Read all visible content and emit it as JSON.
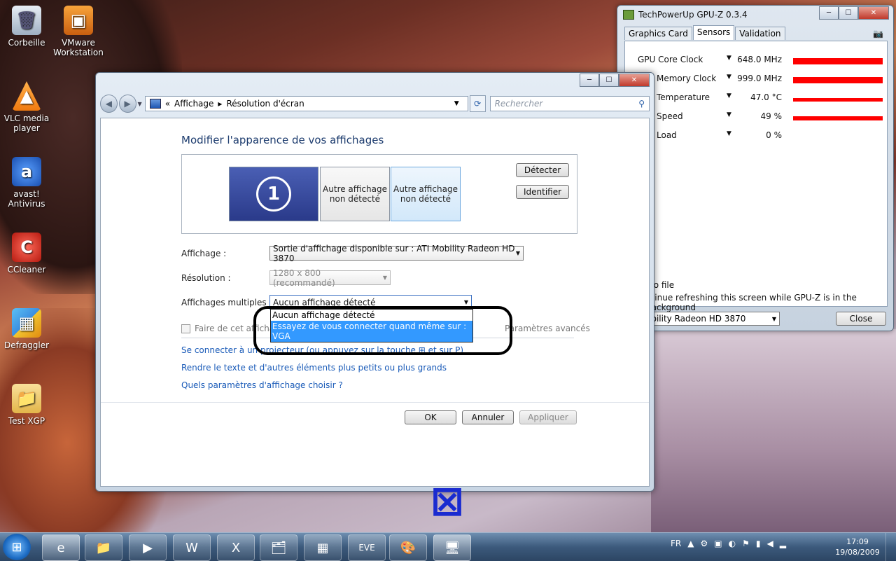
{
  "desktop": {
    "icons": [
      {
        "label": "Corbeille",
        "glyph": "🗑"
      },
      {
        "label": "VMware Workstation",
        "glyph": "▣"
      },
      {
        "label": "VLC media player",
        "glyph": "▲"
      },
      {
        "label": "avast! Antivirus",
        "glyph": "a"
      },
      {
        "label": "CCleaner",
        "glyph": "C"
      },
      {
        "label": "Defraggler",
        "glyph": "▦"
      },
      {
        "label": "Test XGP",
        "glyph": "📁"
      }
    ]
  },
  "window": {
    "address": {
      "sep": "«",
      "crumb1": "Affichage",
      "crumb2": "Résolution d'écran"
    },
    "search_placeholder": "Rechercher",
    "heading": "Modifier l'apparence de vos affichages",
    "monitor1_number": "1",
    "monitor2_label": "Autre affichage non détecté",
    "monitor3_label": "Autre affichage non détecté",
    "detect_button": "Détecter",
    "identify_button": "Identifier",
    "display_label": "Affichage :",
    "display_value": "Sortie d'affichage disponible sur : ATI Mobility Radeon HD 3870",
    "resolution_label": "Résolution :",
    "resolution_value": "1280 x 800 (recommandé)",
    "multiple_label": "Affichages multiples :",
    "multiple_value": "Aucun affichage détecté",
    "dropdown_options": [
      "Aucun affichage détecté",
      "Essayez de vous connecter quand même sur : VGA"
    ],
    "checkbox_label": "Faire de cet affichage",
    "advanced_link": "Paramètres avancés",
    "link_projector": "Se connecter à un projecteur (ou appuyez sur la touche ⊞ et sur P)",
    "link_text_size": "Rendre le texte et d'autres éléments plus petits ou plus grands",
    "link_which_settings": "Quels paramètres d'affichage choisir ?",
    "ok_button": "OK",
    "cancel_button": "Annuler",
    "apply_button": "Appliquer"
  },
  "gpuz": {
    "title": "TechPowerUp GPU-Z 0.3.4",
    "tabs": [
      "Graphics Card",
      "Sensors",
      "Validation"
    ],
    "sensors": [
      {
        "name": "GPU Core Clock",
        "value": "648.0 MHz",
        "level": 1.0
      },
      {
        "name": "Memory Clock",
        "value": "999.0 MHz",
        "level": 1.0
      },
      {
        "name": "Temperature",
        "value": "47.0 °C",
        "level": 1.0
      },
      {
        "name": "Speed",
        "value": "49 %",
        "level": 1.0
      },
      {
        "name": "Load",
        "value": "0 %",
        "level": 0.0
      }
    ],
    "option_log": "to file",
    "option_refresh": "ntinue refreshing this screen while GPU-Z is in the background",
    "gpu_select": "obility Radeon HD 3870",
    "close_button": "Close"
  },
  "taskbar": {
    "items": [
      "e",
      "📁",
      "▶",
      "W",
      "X",
      "🗂",
      "▦",
      "EVE",
      "🎨",
      "🖥"
    ],
    "tray_lang": "FR",
    "time": "17:09",
    "date": "19/08/2009"
  },
  "colors": {
    "sensor_bar": "#ff0000",
    "link": "#1a5bb8",
    "selection": "#3399ff"
  }
}
